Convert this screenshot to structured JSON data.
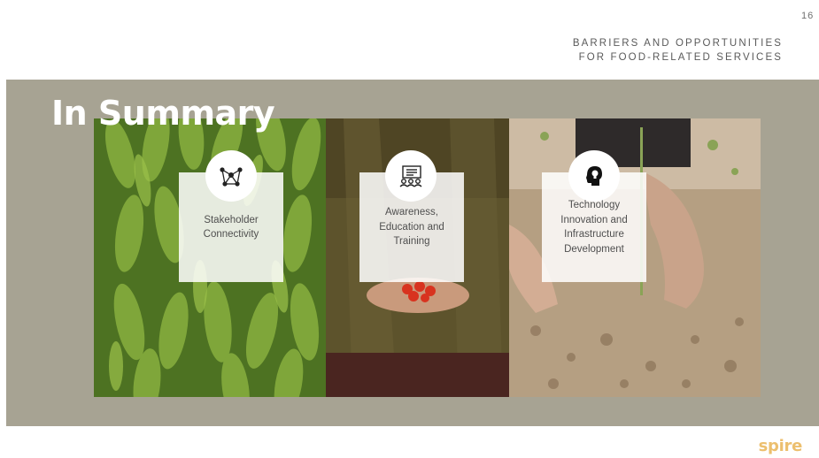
{
  "page": {
    "number": "16"
  },
  "header": {
    "line1": "BARRIERS AND OPPORTUNITIES",
    "line2": "FOR FOOD-RELATED SERVICES"
  },
  "summary": {
    "title": "In Summary"
  },
  "cards": [
    {
      "label": "Stakeholder Connectivity",
      "icon": "network-icon"
    },
    {
      "label": "Awareness, Education and Training",
      "icon": "presentation-icon"
    },
    {
      "label": "Technology Innovation and Infrastructure Development",
      "icon": "head-lightbulb-icon"
    }
  ],
  "logo": {
    "text": "spire"
  },
  "colors": {
    "band": "#a7a393",
    "logo": "#ecbf6e",
    "card_text": "#4f4f4f"
  }
}
